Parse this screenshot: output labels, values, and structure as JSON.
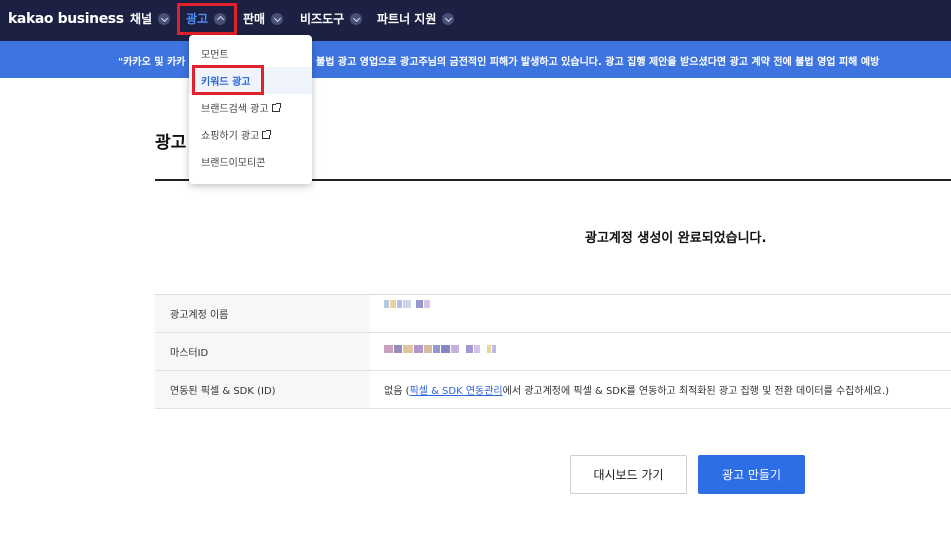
{
  "header": {
    "logo": "kakao business",
    "nav": [
      {
        "label": "채널"
      },
      {
        "label": "광고"
      },
      {
        "label": "판매"
      },
      {
        "label": "비즈도구"
      },
      {
        "label": "파트너 지원"
      }
    ]
  },
  "banner": {
    "text_left": "\"카카오 및 카카",
    "text_right": "불법 광고 영업으로 광고주님의 금전적인 피해가 발생하고 있습니다. 광고 집행 제안을 받으셨다면 광고 계약 전에 불법 영업 피해 예방"
  },
  "dropdown": {
    "items": [
      {
        "label": "모먼트"
      },
      {
        "label": "키워드 광고"
      },
      {
        "label": "브랜드검색 광고"
      },
      {
        "label": "쇼핑하기 광고"
      },
      {
        "label": "브랜드이모티콘"
      }
    ]
  },
  "main": {
    "page_title": "광고",
    "completion_message": "광고계정 생성이 완료되었습니다.",
    "table": {
      "rows": [
        {
          "label": "광고계정 이름"
        },
        {
          "label": "마스터ID"
        },
        {
          "label": "연동된 픽셀 & SDK (ID)",
          "value_prefix": "없음 (",
          "value_link": "픽셀 & SDK 연동관리",
          "value_suffix": "에서 광고계정에 픽셀 & SDK를 연동하고 최적화된 광고 집행 및 전환 데이터를 수집하세요.)"
        }
      ]
    },
    "buttons": {
      "dashboard": "대시보드 가기",
      "create_ad": "광고 만들기"
    }
  },
  "colors": {
    "nav_bg": "#1c2143",
    "banner_bg": "#3d74df",
    "primary": "#2d6ee6",
    "annotation_red": "#e0202a"
  }
}
